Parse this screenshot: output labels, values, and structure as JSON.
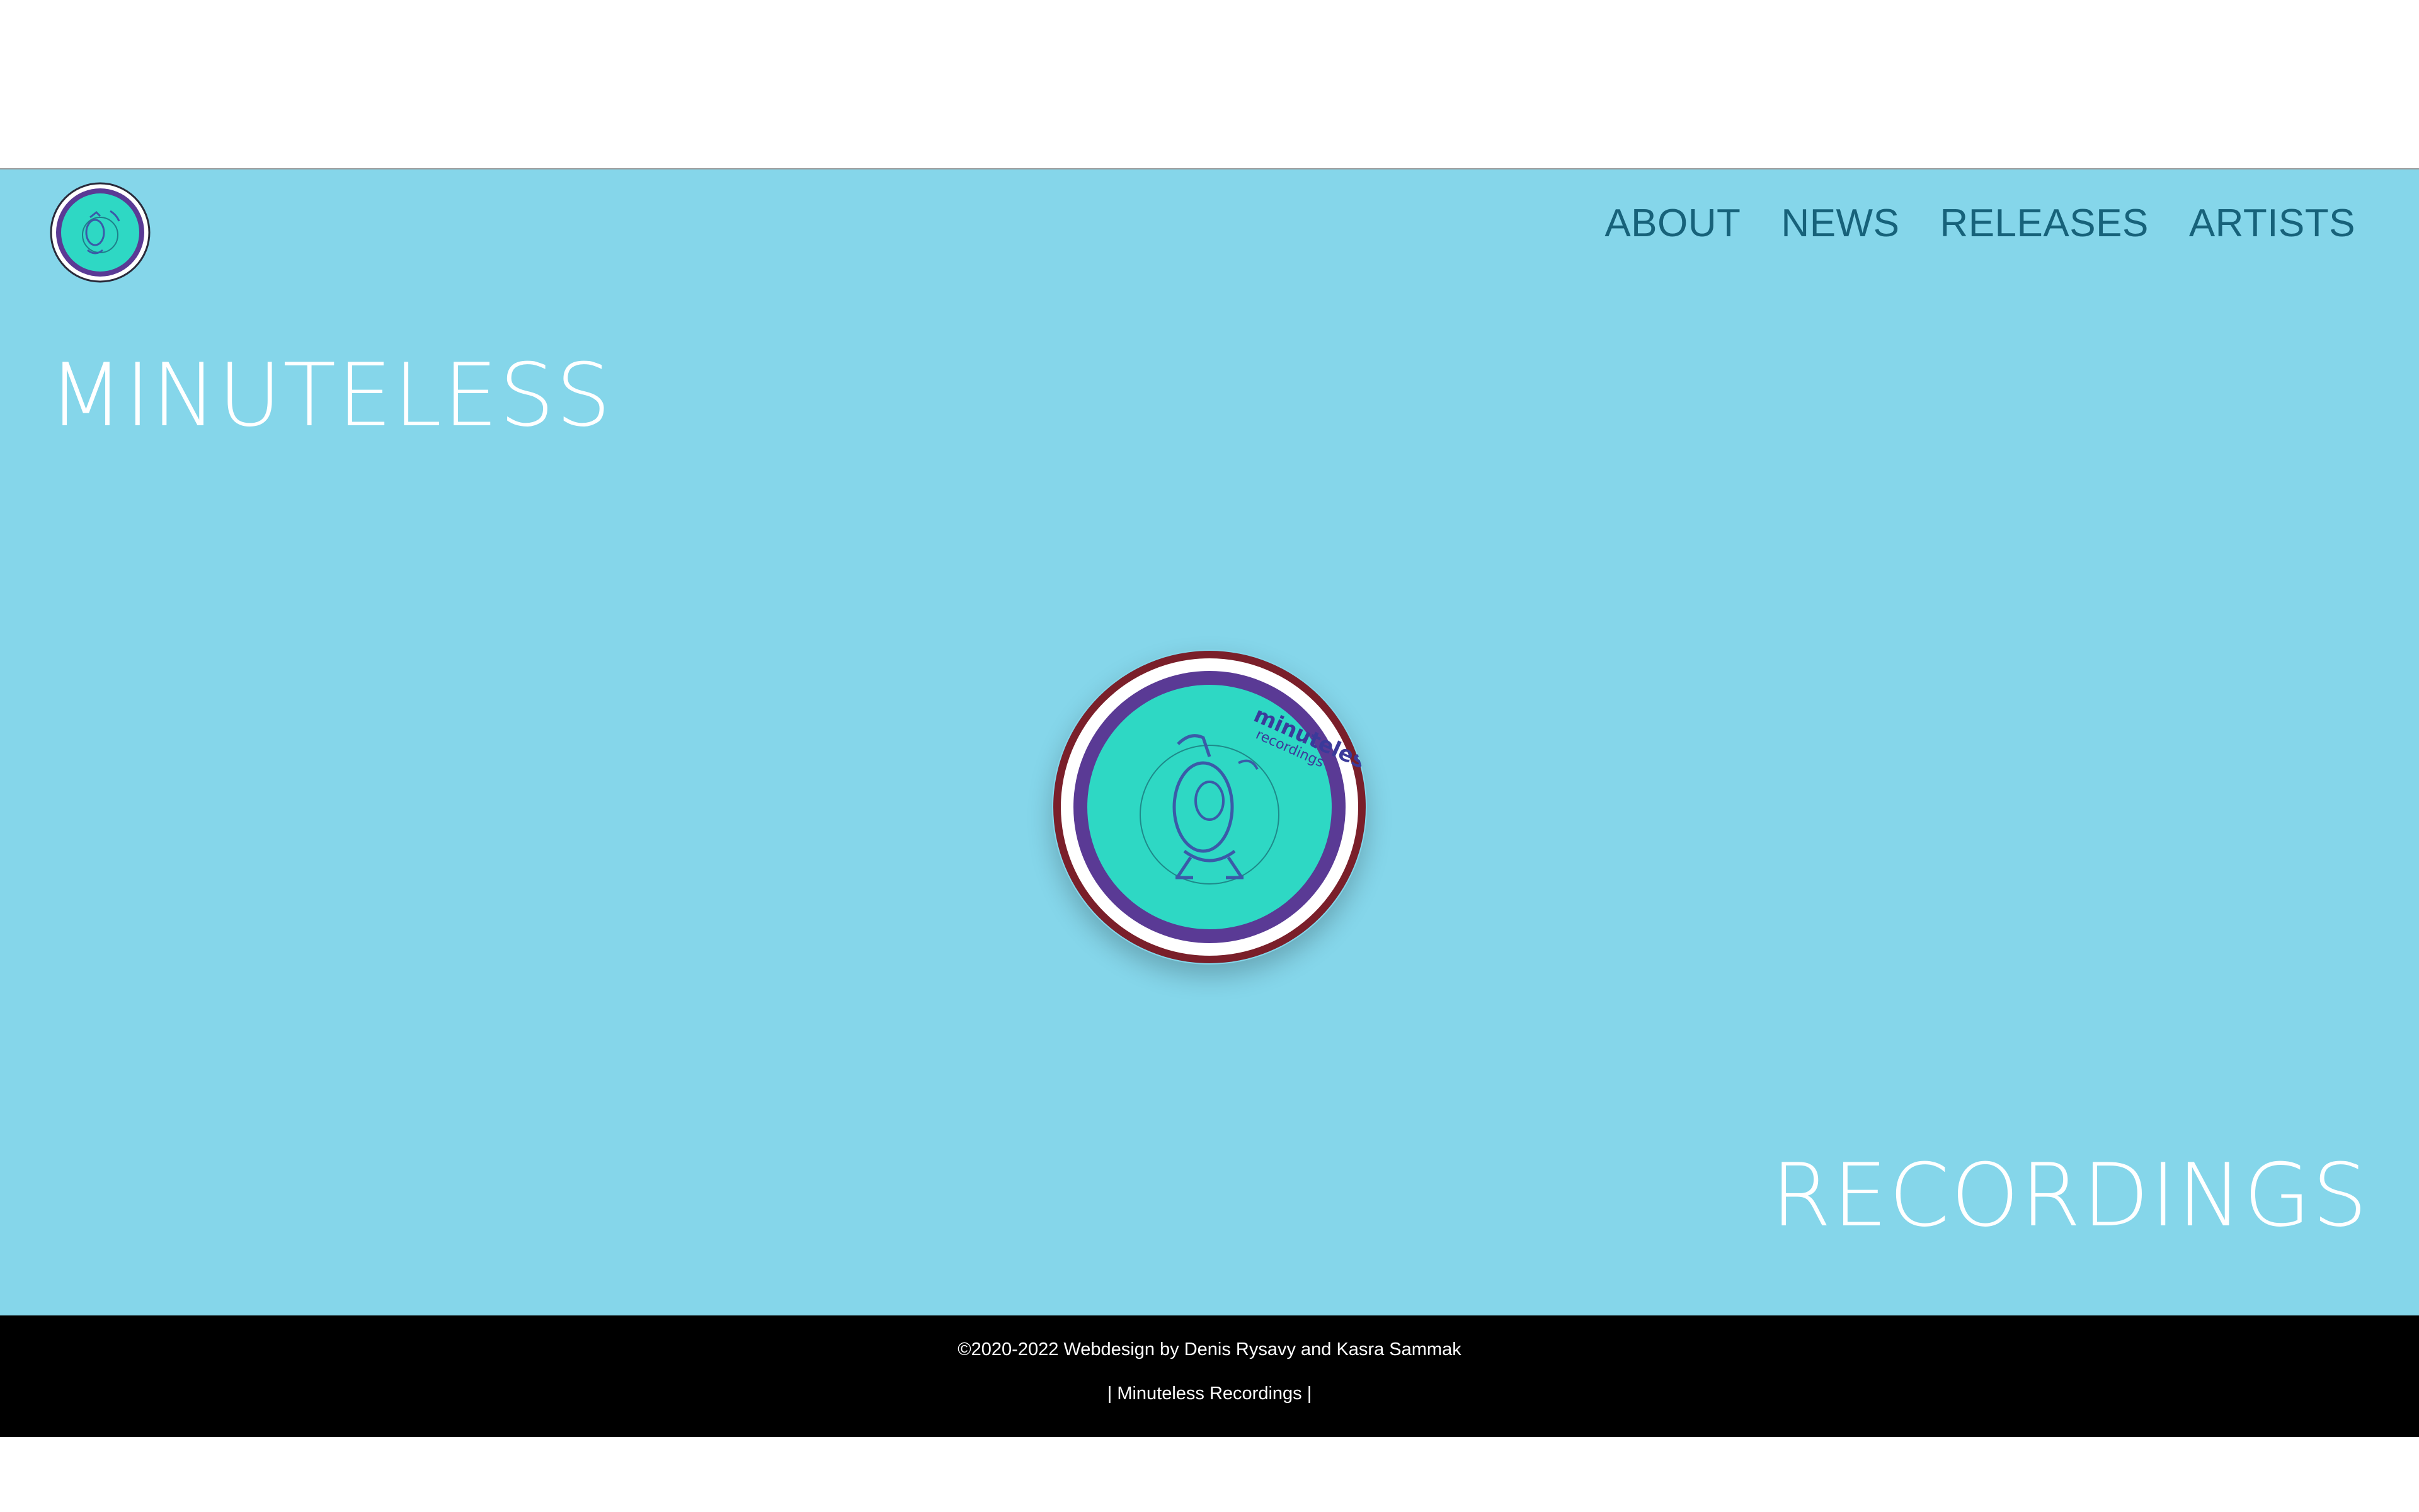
{
  "header": {
    "logo_icon": "minuteless-logo-icon",
    "nav": [
      {
        "label": "ABOUT"
      },
      {
        "label": "NEWS"
      },
      {
        "label": "RELEASES"
      },
      {
        "label": "ARTISTS"
      }
    ]
  },
  "hero": {
    "title_left": "MINUTELESS",
    "title_right": "RECORDINGS",
    "disc_text_1": "minuteless",
    "disc_text_2": "recordings",
    "background_color": "#85d6ea"
  },
  "footer": {
    "copyright": "©2020-2022 Webdesign by Denis Rysavy and Kasra Sammak",
    "link_prefix": "|",
    "link_label": "Minuteless Recordings",
    "link_suffix": "|"
  },
  "colors": {
    "accent": "#17627a",
    "disc_teal": "#2ed8c4",
    "disc_purple": "#5a3a95",
    "disc_rim": "#7a1f2a"
  }
}
